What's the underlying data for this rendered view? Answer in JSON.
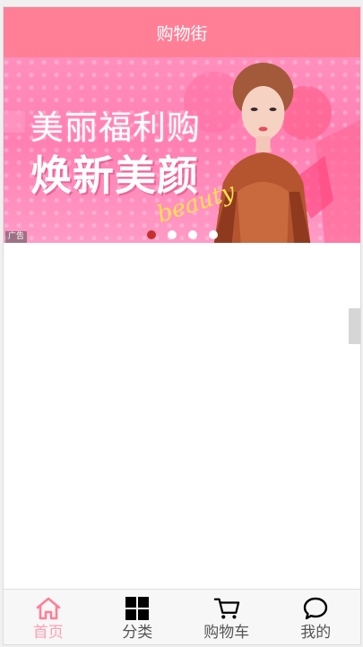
{
  "header": {
    "title": "购物街"
  },
  "banner": {
    "line1": "美丽福利购",
    "line2": "焕新美颜",
    "script_text": "beauty",
    "ad_tag": "广告",
    "slide_count": 4,
    "active_slide_index": 0
  },
  "tabbar": {
    "active_color": "#ff7f97",
    "items": [
      {
        "label": "首页",
        "icon": "home-icon"
      },
      {
        "label": "分类",
        "icon": "grid-icon"
      },
      {
        "label": "购物车",
        "icon": "cart-icon"
      },
      {
        "label": "我的",
        "icon": "chat-bubble-icon"
      }
    ]
  }
}
